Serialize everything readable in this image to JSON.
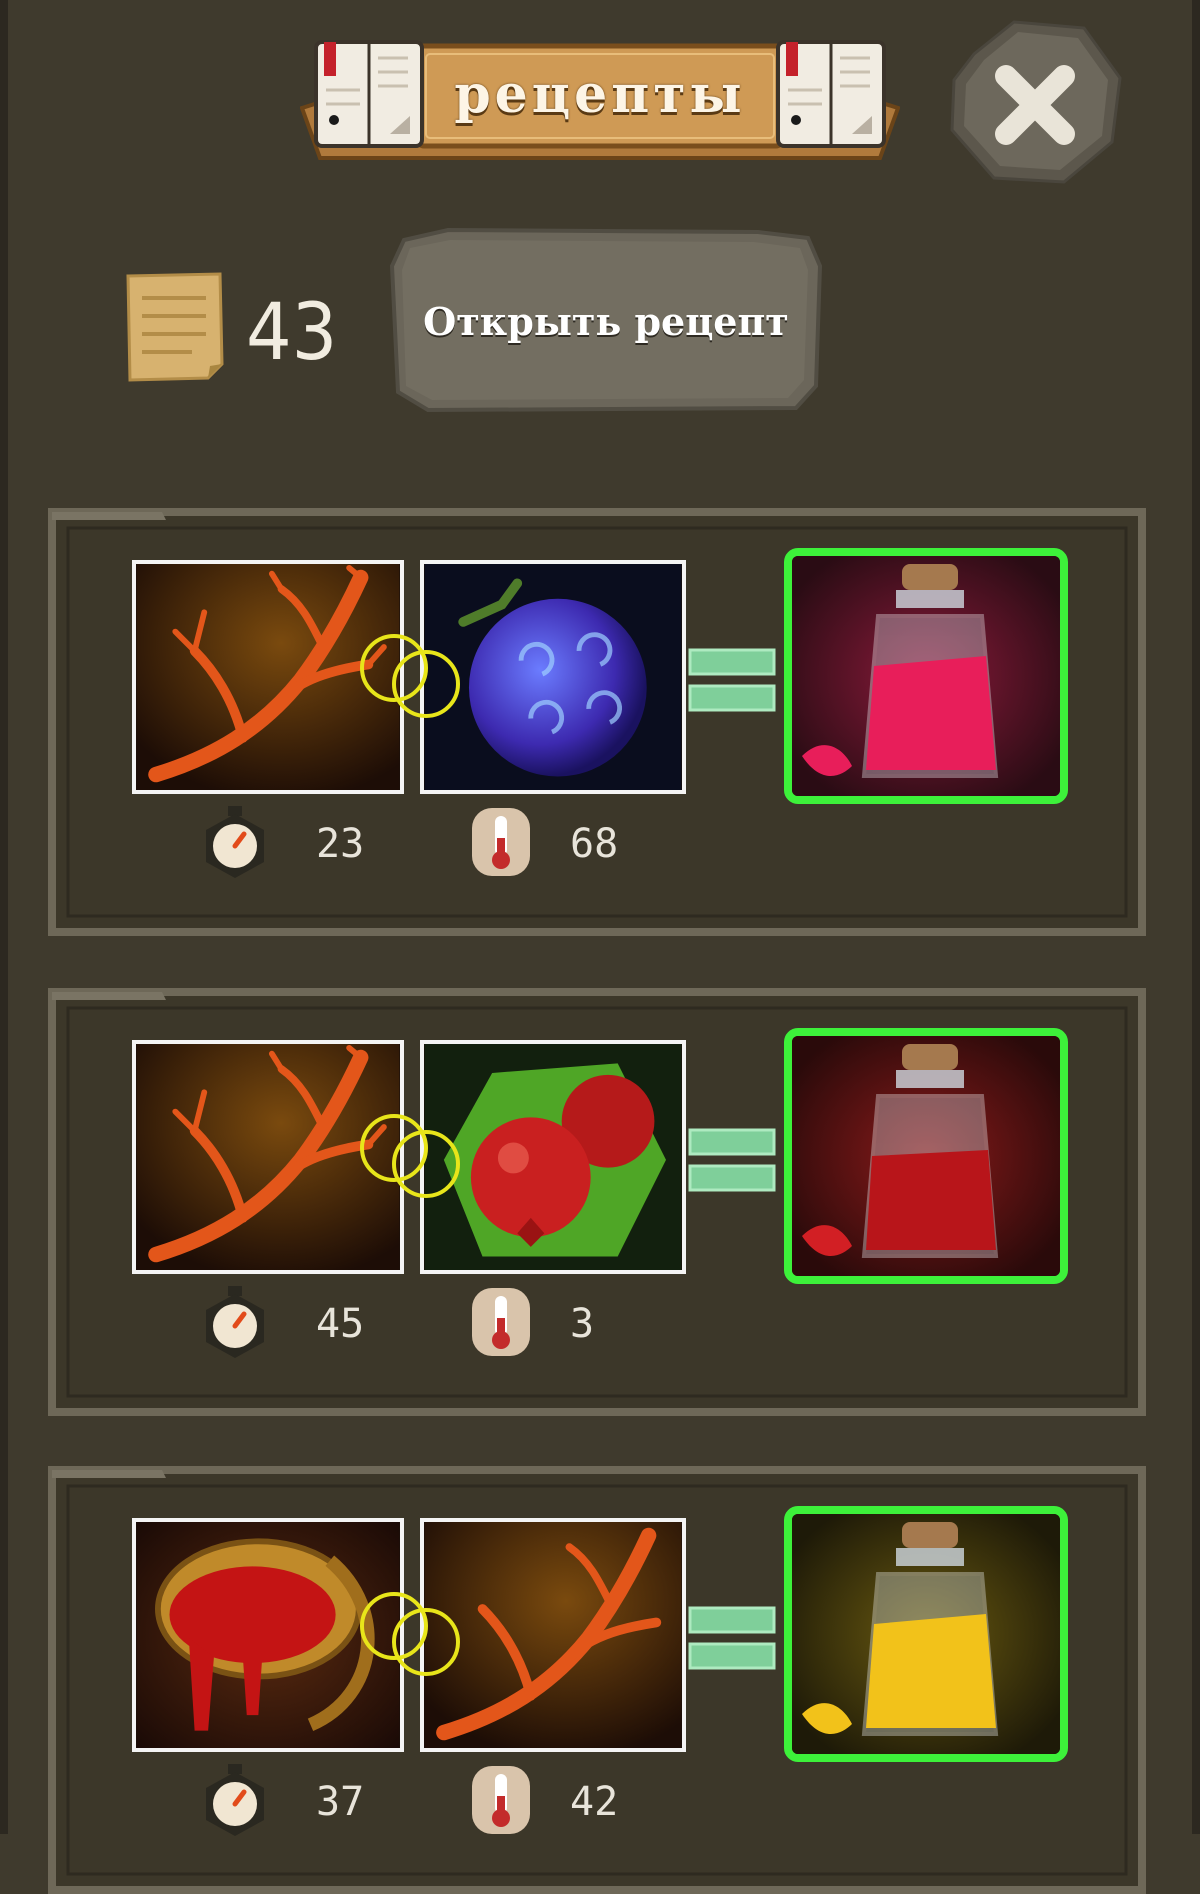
{
  "header": {
    "title": "рецепты"
  },
  "close_button": {
    "icon": "close-icon"
  },
  "scrolls": {
    "count": "43",
    "icon": "scroll-icon"
  },
  "open_recipe_button": {
    "label": "Открыть рецепт"
  },
  "colors": {
    "background": "#3f3a2d",
    "result_border": "#3df13a",
    "link_ring": "#e8e51a",
    "equals": "#7fcf9a"
  },
  "recipes": [
    {
      "ingredients": [
        "coral-branch-icon",
        "blue-swirl-fruit-icon"
      ],
      "result": "red-potion-icon",
      "time": "23",
      "temperature": "68"
    },
    {
      "ingredients": [
        "coral-branch-icon",
        "pomegranate-icon"
      ],
      "result": "dark-red-potion-icon",
      "time": "45",
      "temperature": "3"
    },
    {
      "ingredients": [
        "blood-cauldron-icon",
        "coral-branch-icon"
      ],
      "result": "yellow-potion-icon",
      "time": "37",
      "temperature": "42"
    }
  ]
}
